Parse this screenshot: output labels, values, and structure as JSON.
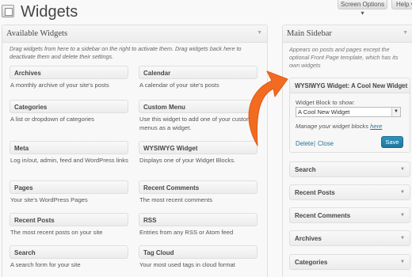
{
  "header": {
    "title": "Widgets",
    "screen_options": "Screen Options ▾",
    "help": "Help ▾"
  },
  "available": {
    "title": "Available Widgets",
    "description": "Drag widgets from here to a sidebar on the right to activate them. Drag widgets back here to deactivate them and delete their settings.",
    "widgets": [
      {
        "label": "Archives",
        "desc": "A monthly archive of your site's posts"
      },
      {
        "label": "Calendar",
        "desc": "A calendar of your site's posts"
      },
      {
        "label": "Categories",
        "desc": "A list or dropdown of categories"
      },
      {
        "label": "Custom Menu",
        "desc": "Use this widget to add one of your custom menus as a widget."
      },
      {
        "label": "Meta",
        "desc": "Log in/out, admin, feed and WordPress links"
      },
      {
        "label": "WYSIWYG Widget",
        "desc": "Displays one of your Widget Blocks."
      },
      {
        "label": "Pages",
        "desc": "Your site's WordPress Pages"
      },
      {
        "label": "Recent Comments",
        "desc": "The most recent comments"
      },
      {
        "label": "Recent Posts",
        "desc": "The most recent posts on your site"
      },
      {
        "label": "RSS",
        "desc": "Entries from any RSS or Atom feed"
      },
      {
        "label": "Search",
        "desc": "A search form for your site"
      },
      {
        "label": "Tag Cloud",
        "desc": "Your most used tags in cloud format"
      }
    ]
  },
  "sidebar": {
    "title": "Main Sidebar",
    "description": "Appears on posts and pages except the optional Front Page template, which has its own widgets",
    "open_widget": {
      "title": "WYSIWYG Widget: A Cool New Widget",
      "field_label": "Widget Block to show:",
      "selected": "A Cool New Widget",
      "manage_prefix": "Manage your widget blocks ",
      "manage_link": "here",
      "delete": "Delete",
      "separator": "|",
      "close": "Close",
      "save": "Save"
    },
    "items": [
      "Search",
      "Recent Posts",
      "Recent Comments",
      "Archives",
      "Categories"
    ]
  },
  "colors": {
    "accent": "#21759b",
    "arrow": "#f26b21"
  },
  "icons": {
    "page_icon": "widgets-page-icon",
    "toggle": "triangle-down-icon",
    "arrow": "curved-arrow-icon"
  }
}
